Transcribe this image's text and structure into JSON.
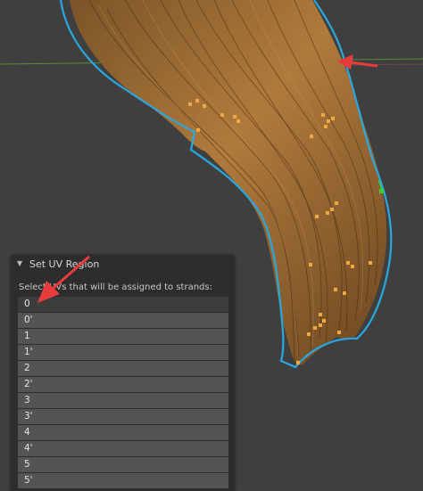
{
  "panel": {
    "title": "Set UV Region",
    "instruction": "Select UVs that will be assigned to strands:",
    "items": [
      "0",
      "0'",
      "1",
      "1'",
      "2",
      "2'",
      "3",
      "3'",
      "4",
      "4'",
      "5",
      "5'"
    ],
    "selected_index": 0
  },
  "colors": {
    "background": "#3f3f3f",
    "outline": "#29a8e0",
    "control_point": "#f0a840",
    "annotation_arrow": "#e83c3c",
    "panel_bg": "#2d2d2d",
    "list_item_bg": "#545454"
  },
  "icons": [
    "collapse-arrow-icon",
    "annotation-arrow-icon",
    "gizmo-icon"
  ]
}
